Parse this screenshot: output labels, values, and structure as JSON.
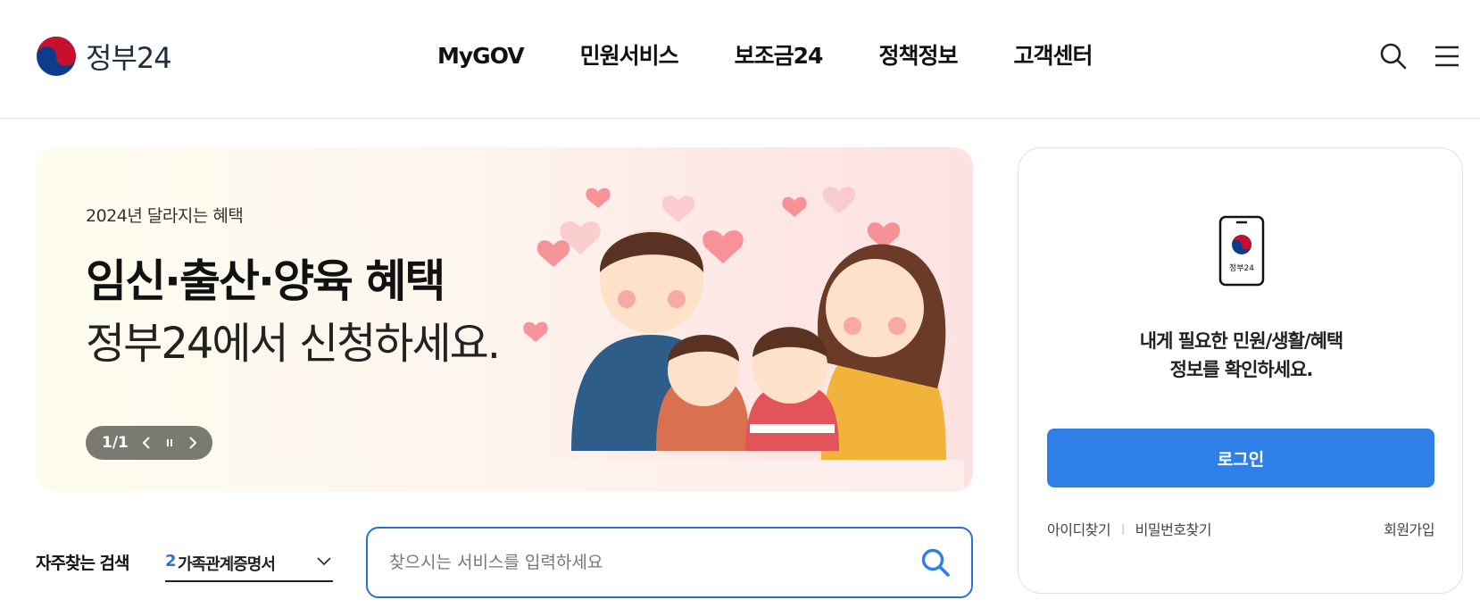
{
  "header": {
    "logo_text": "정부24",
    "nav": [
      "MyGOV",
      "민원서비스",
      "보조금24",
      "정책정보",
      "고객센터"
    ]
  },
  "banner": {
    "subtitle": "2024년 달라지는 혜택",
    "title": "임신·출산·양육 혜택",
    "title2": "정부24에서 신청하세요.",
    "pager": "1/1"
  },
  "search": {
    "frequent_label": "자주찾는 검색",
    "frequent_rank": "2",
    "frequent_value": "가족관계증명서",
    "placeholder": "찾으시는 서비스를 입력하세요"
  },
  "login": {
    "phone_label": "정부24",
    "message_line1": "내게 필요한 민원/생활/혜택",
    "message_line2": "정보를 확인하세요.",
    "button": "로그인",
    "find_id": "아이디찾기",
    "find_pw": "비밀번호찾기",
    "signup": "회원가입",
    "separator": "|"
  },
  "colors": {
    "accent": "#2f7fe8",
    "taeguk_red": "#c8102e",
    "taeguk_blue": "#0f3b8c"
  }
}
